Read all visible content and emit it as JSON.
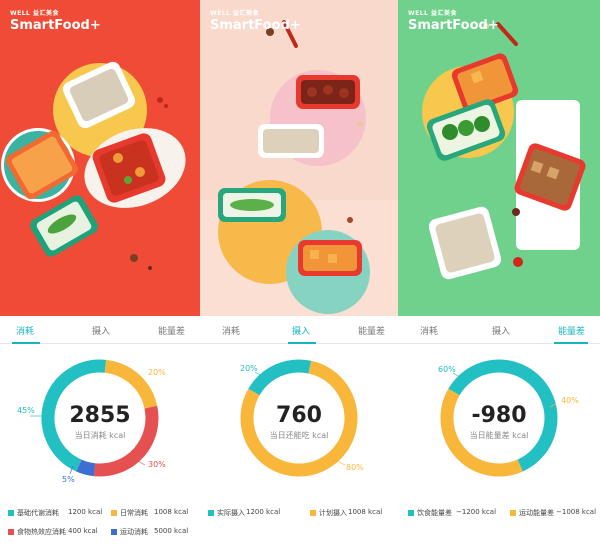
{
  "brand": {
    "top": "WELL 益汇美食",
    "main": "SmartFood+"
  },
  "colors": {
    "teal": "#22bfc3",
    "yellow": "#f8b73a",
    "red": "#e55050",
    "blue": "#3d6fd3",
    "active_tab": "#16b5c0"
  },
  "screens": [
    {
      "tabs": [
        "消耗",
        "摄入",
        "能量差"
      ],
      "active_tab": 0,
      "center_value": "2855",
      "center_label": "当日消耗 kcal",
      "percent_labels": [
        "45%",
        "20%",
        "30%",
        "5%"
      ],
      "legend": [
        {
          "label": "基础代谢消耗",
          "value": "1200 kcal"
        },
        {
          "label": "日常消耗",
          "value": "1008 kcal"
        },
        {
          "label": "食物热效应消耗",
          "value": "400 kcal"
        },
        {
          "label": "运动消耗",
          "value": "5000 kcal"
        }
      ]
    },
    {
      "tabs": [
        "消耗",
        "摄入",
        "能量差"
      ],
      "active_tab": 1,
      "center_value": "760",
      "center_label": "当日还能吃 kcal",
      "percent_labels": [
        "20%",
        "80%"
      ],
      "legend": [
        {
          "label": "实际摄入",
          "value": "1200 kcal"
        },
        {
          "label": "计划摄入",
          "value": "1008 kcal"
        }
      ]
    },
    {
      "tabs": [
        "消耗",
        "摄入",
        "能量差"
      ],
      "active_tab": 2,
      "center_value": "-980",
      "center_label": "当日能量差 kcal",
      "percent_labels": [
        "60%",
        "40%"
      ],
      "legend": [
        {
          "label": "饮食能量差",
          "value": "−1200 kcal"
        },
        {
          "label": "运动能量差",
          "value": "−1008 kcal"
        }
      ]
    }
  ],
  "chart_data": [
    {
      "type": "pie",
      "series": [
        {
          "values": [
            45,
            20,
            30,
            5
          ]
        }
      ]
    },
    {
      "type": "pie",
      "series": [
        {
          "values": [
            20,
            80
          ]
        }
      ]
    },
    {
      "type": "pie",
      "series": [
        {
          "values": [
            60,
            40
          ]
        }
      ]
    }
  ]
}
